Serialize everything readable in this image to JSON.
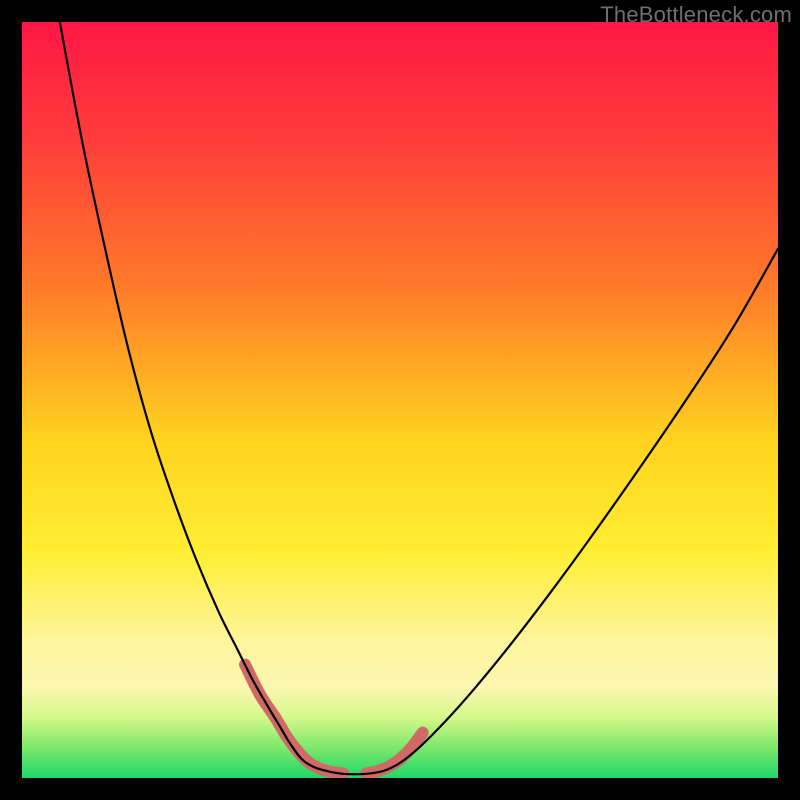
{
  "watermark": "TheBottleneck.com",
  "chart_data": {
    "type": "line",
    "title": "",
    "xlabel": "",
    "ylabel": "",
    "xlim": [
      0,
      100
    ],
    "ylim": [
      0,
      100
    ],
    "gradient_stops": [
      {
        "offset": 0.0,
        "color": "#ff1744"
      },
      {
        "offset": 0.15,
        "color": "#ff3b3b"
      },
      {
        "offset": 0.35,
        "color": "#ff7a2a"
      },
      {
        "offset": 0.55,
        "color": "#ffd21f"
      },
      {
        "offset": 0.7,
        "color": "#ffee33"
      },
      {
        "offset": 0.82,
        "color": "#fff59d"
      },
      {
        "offset": 0.88,
        "color": "#fbf6b0"
      },
      {
        "offset": 0.92,
        "color": "#d5f88a"
      },
      {
        "offset": 0.96,
        "color": "#7be86a"
      },
      {
        "offset": 1.0,
        "color": "#1fd86b"
      }
    ],
    "series": [
      {
        "name": "left-branch",
        "x": [
          5.0,
          8.0,
          11.0,
          14.0,
          17.0,
          20.0,
          23.0,
          26.0,
          28.5,
          30.5,
          32.5,
          34.0,
          35.5,
          37.0,
          38.5,
          40.0
        ],
        "y": [
          100.0,
          84.0,
          70.0,
          57.0,
          46.0,
          37.0,
          29.0,
          22.0,
          17.0,
          13.0,
          9.5,
          7.0,
          4.5,
          2.5,
          1.5,
          1.0
        ]
      },
      {
        "name": "valley-floor",
        "x": [
          40.0,
          42.0,
          44.0,
          46.0,
          48.0
        ],
        "y": [
          1.0,
          0.6,
          0.5,
          0.6,
          1.0
        ]
      },
      {
        "name": "right-branch",
        "x": [
          48.0,
          50.0,
          52.5,
          56.0,
          60.0,
          64.5,
          69.5,
          75.0,
          81.0,
          87.5,
          94.0,
          100.0
        ],
        "y": [
          1.0,
          2.0,
          4.0,
          7.5,
          12.0,
          17.5,
          24.0,
          31.5,
          40.0,
          49.5,
          59.5,
          70.0
        ]
      }
    ],
    "highlight_segments": [
      {
        "name": "left-highlight",
        "x": [
          29.5,
          31.5,
          33.5,
          35.0,
          36.5,
          38.0,
          39.5,
          41.0,
          42.5
        ],
        "y": [
          15.0,
          11.0,
          8.0,
          5.5,
          3.5,
          2.0,
          1.2,
          0.8,
          0.6
        ]
      },
      {
        "name": "right-highlight",
        "x": [
          45.5,
          47.0,
          48.5,
          50.0,
          51.5,
          53.0
        ],
        "y": [
          0.6,
          0.9,
          1.5,
          2.5,
          4.0,
          6.0
        ]
      }
    ],
    "curve_stroke": "#000000",
    "curve_width": 2.2,
    "highlight_stroke": "#cf6a67",
    "highlight_width": 12
  }
}
